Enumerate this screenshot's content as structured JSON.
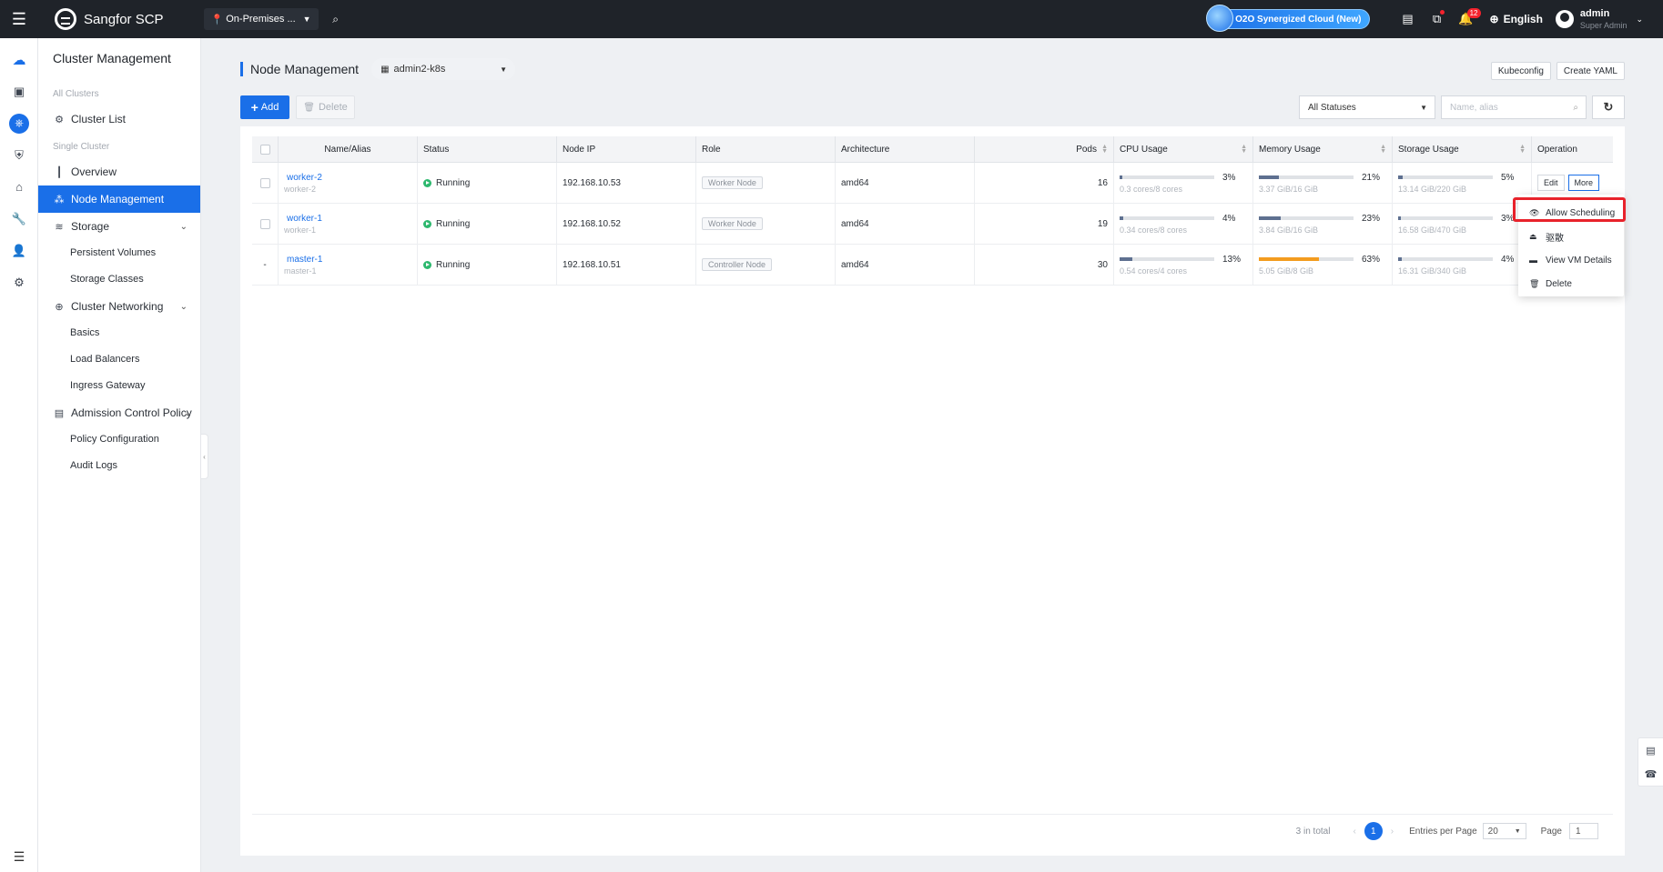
{
  "topbar": {
    "brand": "Sangfor SCP",
    "location": "On-Premises ...",
    "promo": "O2O Synergized Cloud (New)",
    "notification_count": "12",
    "language": "English",
    "user_name": "admin",
    "user_role": "Super Admin"
  },
  "sidebar": {
    "title": "Cluster Management",
    "group_all": "All Clusters",
    "cluster_list": "Cluster List",
    "group_single": "Single Cluster",
    "overview": "Overview",
    "node_management": "Node Management",
    "storage": "Storage",
    "persistent_volumes": "Persistent Volumes",
    "storage_classes": "Storage Classes",
    "cluster_networking": "Cluster Networking",
    "basics": "Basics",
    "load_balancers": "Load Balancers",
    "ingress_gateway": "Ingress Gateway",
    "admission_control": "Admission Control Policy",
    "policy_configuration": "Policy Configuration",
    "audit_logs": "Audit Logs"
  },
  "page": {
    "title": "Node Management",
    "cluster": "admin2-k8s",
    "kubeconfig": "Kubeconfig",
    "create_yaml": "Create YAML",
    "add": "Add",
    "delete": "Delete",
    "status_filter": "All Statuses",
    "search_placeholder": "Name, alias"
  },
  "table": {
    "headers": {
      "name": "Name/Alias",
      "status": "Status",
      "ip": "Node IP",
      "role": "Role",
      "arch": "Architecture",
      "pods": "Pods",
      "cpu": "CPU Usage",
      "mem": "Memory Usage",
      "sto": "Storage Usage",
      "op": "Operation"
    },
    "rows": [
      {
        "name": "worker-2",
        "alias": "worker-2",
        "status": "Running",
        "ip": "192.168.10.53",
        "role": "Worker Node",
        "arch": "amd64",
        "pods": "16",
        "cpu_pct": "3%",
        "cpu_val": 3,
        "cpu_sub": "0.3 cores/8 cores",
        "mem_pct": "21%",
        "mem_val": 21,
        "mem_sub": "3.37 GiB/16 GiB",
        "sto_pct": "5%",
        "sto_val": 5,
        "sto_sub": "13.14 GiB/220 GiB",
        "checkbox": true
      },
      {
        "name": "worker-1",
        "alias": "worker-1",
        "status": "Running",
        "ip": "192.168.10.52",
        "role": "Worker Node",
        "arch": "amd64",
        "pods": "19",
        "cpu_pct": "4%",
        "cpu_val": 4,
        "cpu_sub": "0.34 cores/8 cores",
        "mem_pct": "23%",
        "mem_val": 23,
        "mem_sub": "3.84 GiB/16 GiB",
        "sto_pct": "3%",
        "sto_val": 3,
        "sto_sub": "16.58 GiB/470 GiB",
        "checkbox": true
      },
      {
        "name": "master-1",
        "alias": "master-1",
        "status": "Running",
        "ip": "192.168.10.51",
        "role": "Controller Node",
        "arch": "amd64",
        "pods": "30",
        "cpu_pct": "13%",
        "cpu_val": 13,
        "cpu_sub": "0.54 cores/4 cores",
        "mem_pct": "63%",
        "mem_val": 63,
        "mem_sub": "5.05 GiB/8 GiB",
        "sto_pct": "4%",
        "sto_val": 4,
        "sto_sub": "16.31 GiB/340 GiB",
        "checkbox": false
      }
    ],
    "edit": "Edit",
    "more": "More",
    "no_checkbox_mark": "-"
  },
  "more_menu": {
    "allow_scheduling": "Allow Scheduling",
    "evict": "驱散",
    "view_vm_details": "View VM Details",
    "delete": "Delete"
  },
  "pager": {
    "total": "3 in total",
    "current": "1",
    "entries_label": "Entries per Page",
    "entries": "20",
    "page_label": "Page",
    "page_value": "1"
  },
  "colors": {
    "accent": "#1a6fe8",
    "running": "#2db86e",
    "warning": "#f39c1f",
    "highlight": "#e8222b"
  }
}
